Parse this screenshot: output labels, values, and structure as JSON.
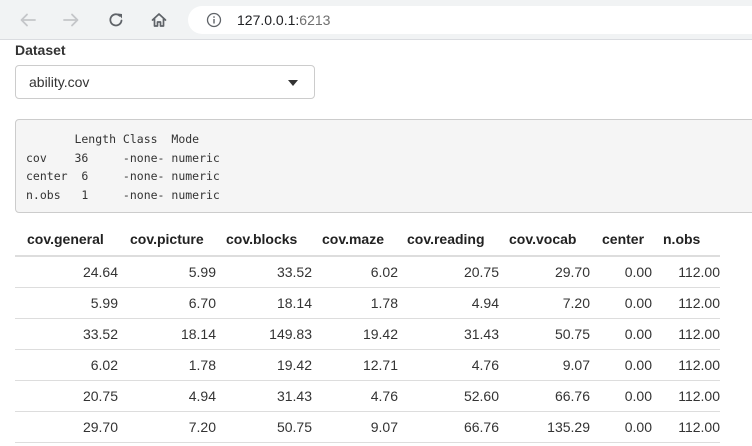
{
  "browser": {
    "url_host": "127.0.0.1:",
    "url_port": "6213"
  },
  "dataset": {
    "label": "Dataset",
    "selected": "ability.cov"
  },
  "summary": {
    "lines": [
      "       Length Class  Mode   ",
      "cov    36     -none- numeric",
      "center  6     -none- numeric",
      "n.obs   1     -none- numeric"
    ]
  },
  "table": {
    "headers": [
      "cov.general",
      "cov.picture",
      "cov.blocks",
      "cov.maze",
      "cov.reading",
      "cov.vocab",
      "center",
      "n.obs"
    ],
    "rows": [
      [
        "24.64",
        "5.99",
        "33.52",
        "6.02",
        "20.75",
        "29.70",
        "0.00",
        "112.00"
      ],
      [
        "5.99",
        "6.70",
        "18.14",
        "1.78",
        "4.94",
        "7.20",
        "0.00",
        "112.00"
      ],
      [
        "33.52",
        "18.14",
        "149.83",
        "19.42",
        "31.43",
        "50.75",
        "0.00",
        "112.00"
      ],
      [
        "6.02",
        "1.78",
        "19.42",
        "12.71",
        "4.76",
        "9.07",
        "0.00",
        "112.00"
      ],
      [
        "20.75",
        "4.94",
        "31.43",
        "4.76",
        "52.60",
        "66.76",
        "0.00",
        "112.00"
      ],
      [
        "29.70",
        "7.20",
        "50.75",
        "9.07",
        "66.76",
        "135.29",
        "0.00",
        "112.00"
      ]
    ]
  }
}
